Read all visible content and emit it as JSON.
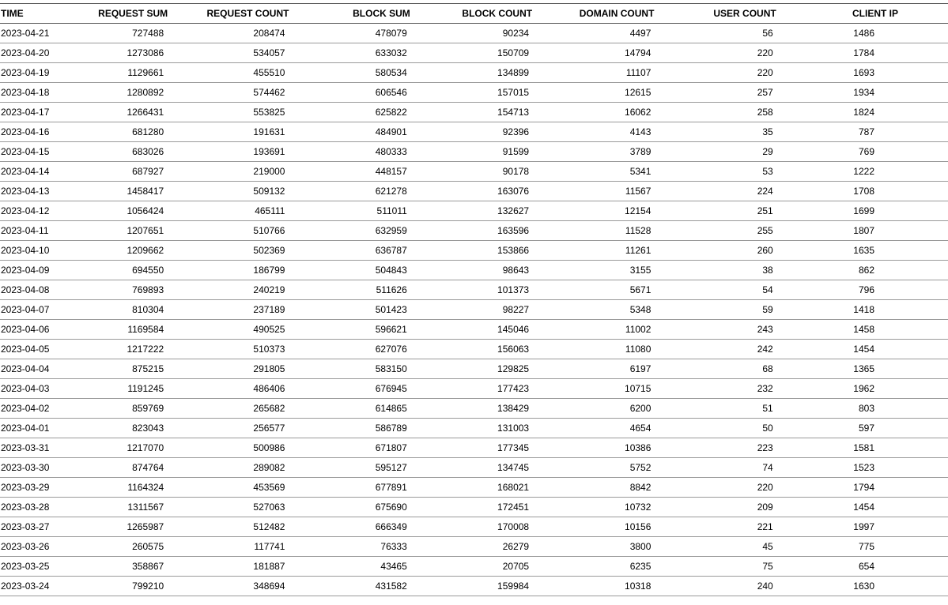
{
  "table": {
    "columns": [
      "TIME",
      "REQUEST SUM",
      "REQUEST COUNT",
      "BLOCK SUM",
      "BLOCK COUNT",
      "DOMAIN COUNT",
      "USER COUNT",
      "CLIENT IP"
    ],
    "rows": [
      [
        "2023-04-21",
        "727488",
        "208474",
        "478079",
        "90234",
        "4497",
        "56",
        "1486"
      ],
      [
        "2023-04-20",
        "1273086",
        "534057",
        "633032",
        "150709",
        "14794",
        "220",
        "1784"
      ],
      [
        "2023-04-19",
        "1129661",
        "455510",
        "580534",
        "134899",
        "11107",
        "220",
        "1693"
      ],
      [
        "2023-04-18",
        "1280892",
        "574462",
        "606546",
        "157015",
        "12615",
        "257",
        "1934"
      ],
      [
        "2023-04-17",
        "1266431",
        "553825",
        "625822",
        "154713",
        "16062",
        "258",
        "1824"
      ],
      [
        "2023-04-16",
        "681280",
        "191631",
        "484901",
        "92396",
        "4143",
        "35",
        "787"
      ],
      [
        "2023-04-15",
        "683026",
        "193691",
        "480333",
        "91599",
        "3789",
        "29",
        "769"
      ],
      [
        "2023-04-14",
        "687927",
        "219000",
        "448157",
        "90178",
        "5341",
        "53",
        "1222"
      ],
      [
        "2023-04-13",
        "1458417",
        "509132",
        "621278",
        "163076",
        "11567",
        "224",
        "1708"
      ],
      [
        "2023-04-12",
        "1056424",
        "465111",
        "511011",
        "132627",
        "12154",
        "251",
        "1699"
      ],
      [
        "2023-04-11",
        "1207651",
        "510766",
        "632959",
        "163596",
        "11528",
        "255",
        "1807"
      ],
      [
        "2023-04-10",
        "1209662",
        "502369",
        "636787",
        "153866",
        "11261",
        "260",
        "1635"
      ],
      [
        "2023-04-09",
        "694550",
        "186799",
        "504843",
        "98643",
        "3155",
        "38",
        "862"
      ],
      [
        "2023-04-08",
        "769893",
        "240219",
        "511626",
        "101373",
        "5671",
        "54",
        "796"
      ],
      [
        "2023-04-07",
        "810304",
        "237189",
        "501423",
        "98227",
        "5348",
        "59",
        "1418"
      ],
      [
        "2023-04-06",
        "1169584",
        "490525",
        "596621",
        "145046",
        "11002",
        "243",
        "1458"
      ],
      [
        "2023-04-05",
        "1217222",
        "510373",
        "627076",
        "156063",
        "11080",
        "242",
        "1454"
      ],
      [
        "2023-04-04",
        "875215",
        "291805",
        "583150",
        "129825",
        "6197",
        "68",
        "1365"
      ],
      [
        "2023-04-03",
        "1191245",
        "486406",
        "676945",
        "177423",
        "10715",
        "232",
        "1962"
      ],
      [
        "2023-04-02",
        "859769",
        "265682",
        "614865",
        "138429",
        "6200",
        "51",
        "803"
      ],
      [
        "2023-04-01",
        "823043",
        "256577",
        "586789",
        "131003",
        "4654",
        "50",
        "597"
      ],
      [
        "2023-03-31",
        "1217070",
        "500986",
        "671807",
        "177345",
        "10386",
        "223",
        "1581"
      ],
      [
        "2023-03-30",
        "874764",
        "289082",
        "595127",
        "134745",
        "5752",
        "74",
        "1523"
      ],
      [
        "2023-03-29",
        "1164324",
        "453569",
        "677891",
        "168021",
        "8842",
        "220",
        "1794"
      ],
      [
        "2023-03-28",
        "1311567",
        "527063",
        "675690",
        "172451",
        "10732",
        "209",
        "1454"
      ],
      [
        "2023-03-27",
        "1265987",
        "512482",
        "666349",
        "170008",
        "10156",
        "221",
        "1997"
      ],
      [
        "2023-03-26",
        "260575",
        "117741",
        "76333",
        "26279",
        "3800",
        "45",
        "775"
      ],
      [
        "2023-03-25",
        "358867",
        "181887",
        "43465",
        "20705",
        "6235",
        "75",
        "654"
      ],
      [
        "2023-03-24",
        "799210",
        "348694",
        "431582",
        "159984",
        "10318",
        "240",
        "1630"
      ]
    ]
  }
}
